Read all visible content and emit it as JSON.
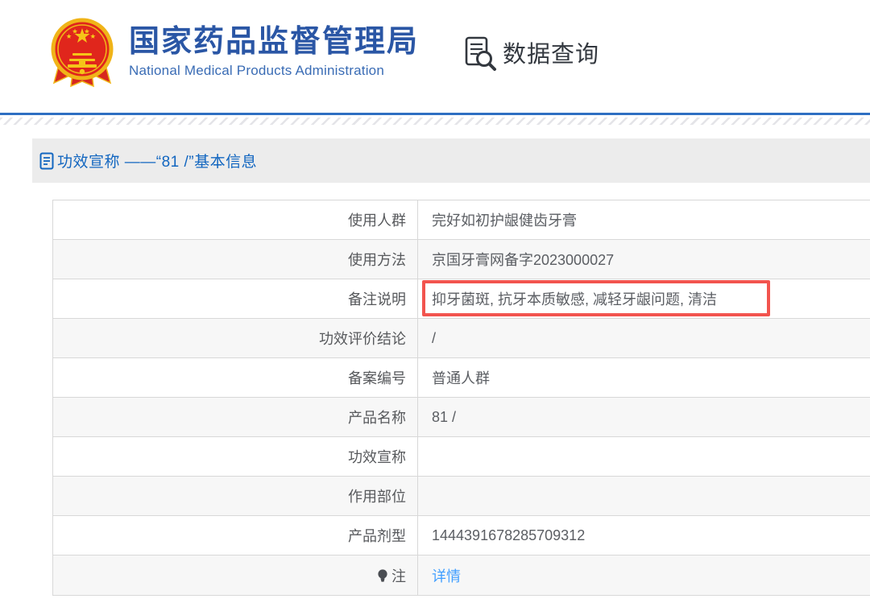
{
  "header": {
    "org_name_zh": "国家药品监督管理局",
    "org_name_en": "National Medical Products Administration",
    "nav_title": "数据查询"
  },
  "section": {
    "title": "功效宣称 ——“81 /”基本信息"
  },
  "table": {
    "rows": [
      {
        "label": "使用人群",
        "value": "完好如初护龈健齿牙膏",
        "highlight": false,
        "link": false,
        "bulb": false
      },
      {
        "label": "使用方法",
        "value": "京国牙膏网备字2023000027",
        "highlight": false,
        "link": false,
        "bulb": false
      },
      {
        "label": "备注说明",
        "value": "抑牙菌斑, 抗牙本质敏感, 减轻牙龈问题, 清洁",
        "highlight": true,
        "link": false,
        "bulb": false
      },
      {
        "label": "功效评价结论",
        "value": "/",
        "highlight": false,
        "link": false,
        "bulb": false
      },
      {
        "label": "备案编号",
        "value": "普通人群",
        "highlight": false,
        "link": false,
        "bulb": false
      },
      {
        "label": "产品名称",
        "value": "81 /",
        "highlight": false,
        "link": false,
        "bulb": false
      },
      {
        "label": "功效宣称",
        "value": "",
        "highlight": false,
        "link": false,
        "bulb": false
      },
      {
        "label": "作用部位",
        "value": "",
        "highlight": false,
        "link": false,
        "bulb": false
      },
      {
        "label": "产品剂型",
        "value": "1444391678285709312",
        "highlight": false,
        "link": false,
        "bulb": false
      },
      {
        "label": "注",
        "value": "详情",
        "highlight": false,
        "link": true,
        "bulb": true
      }
    ]
  },
  "colors": {
    "brand_blue": "#2a56a5",
    "title_blue": "#1266c0",
    "link_blue": "#409eff",
    "highlight_red": "#f2544e",
    "divider_blue": "#2e6fc2"
  }
}
